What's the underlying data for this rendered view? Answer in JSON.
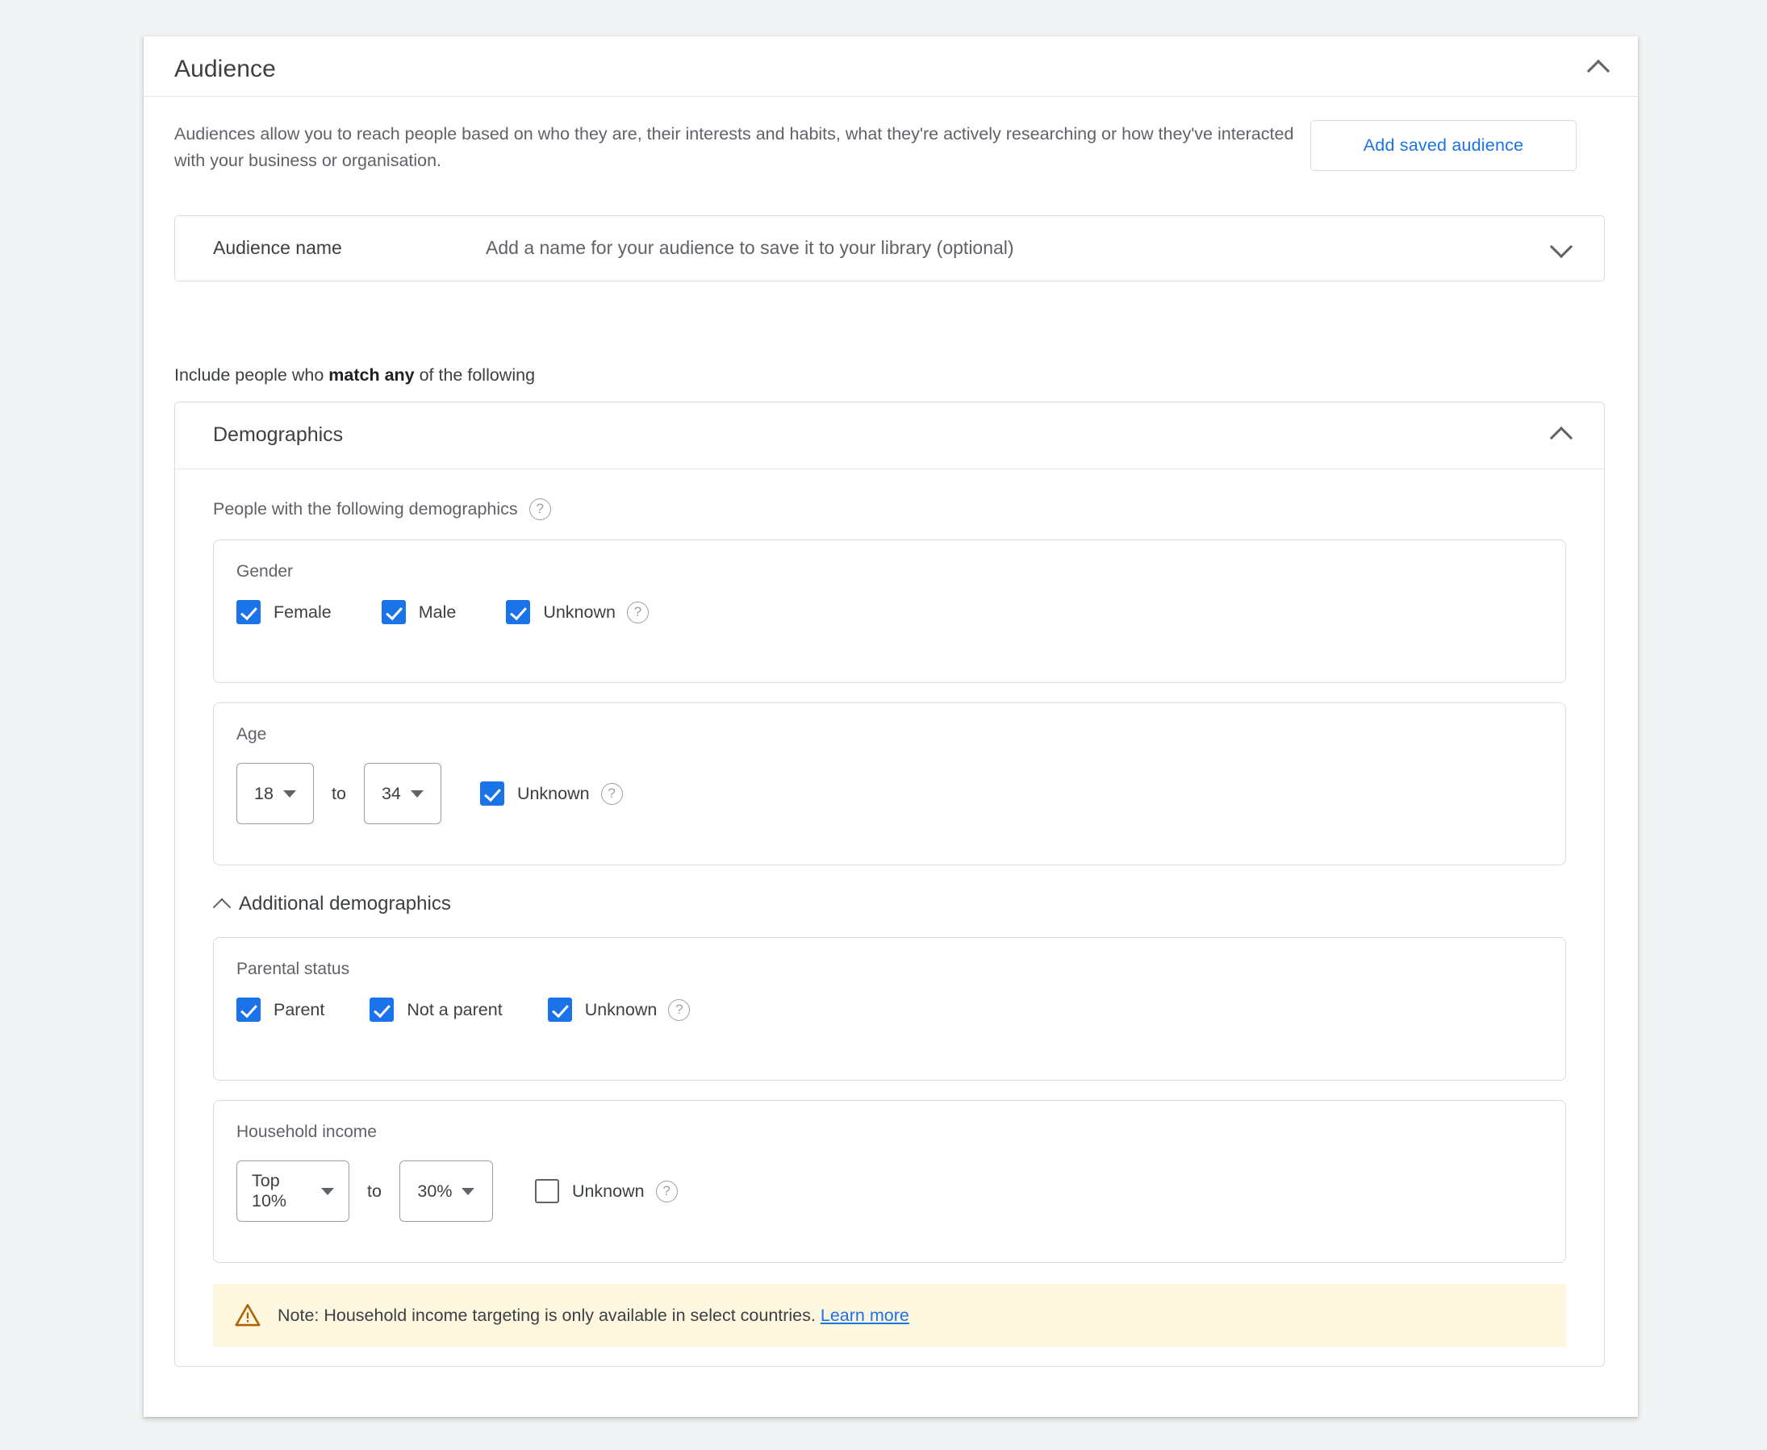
{
  "card": {
    "title": "Audience",
    "collapse_icon": "chevron-up-icon",
    "intro": "Audiences allow you to reach people based on who they are, their interests and habits, what they're actively researching or how they've interacted with your business or organisation.",
    "add_saved_audience_label": "Add saved audience"
  },
  "audience_name": {
    "label": "Audience name",
    "placeholder": "Add a name for your audience to save it to your library (optional)",
    "expand_icon": "chevron-down-icon"
  },
  "include_line": {
    "prefix": "Include people who ",
    "emphasis": "match any",
    "suffix": " of the following"
  },
  "demographics": {
    "title": "Demographics",
    "collapse_icon": "chevron-up-icon",
    "subtitle": "People with the following demographics",
    "subtitle_help_icon": "help-icon",
    "gender": {
      "label": "Gender",
      "options": [
        {
          "label": "Female",
          "checked": true
        },
        {
          "label": "Male",
          "checked": true
        },
        {
          "label": "Unknown",
          "checked": true,
          "help": true
        }
      ]
    },
    "age": {
      "label": "Age",
      "from": "18",
      "to_word": "to",
      "to": "34",
      "unknown": {
        "label": "Unknown",
        "checked": true,
        "help": true
      }
    },
    "additional_toggle": {
      "label": "Additional demographics",
      "icon": "chevron-up-icon"
    },
    "parental_status": {
      "label": "Parental status",
      "options": [
        {
          "label": "Parent",
          "checked": true
        },
        {
          "label": "Not a parent",
          "checked": true
        },
        {
          "label": "Unknown",
          "checked": true,
          "help": true
        }
      ]
    },
    "household_income": {
      "label": "Household income",
      "from": "Top 10%",
      "to_word": "to",
      "to": "30%",
      "unknown": {
        "label": "Unknown",
        "checked": false,
        "help": true
      }
    },
    "note": {
      "icon": "warning-triangle-icon",
      "text": "Note: Household income targeting is only available in select countries.",
      "link_label": "Learn more"
    }
  },
  "colors": {
    "accent_blue": "#1a73e8",
    "text_primary": "#3c4043",
    "text_secondary": "#5f6368",
    "border": "#dadce0",
    "note_background": "#fef7e0",
    "warning_amber": "#b06000",
    "page_background": "#f1f3f4"
  }
}
